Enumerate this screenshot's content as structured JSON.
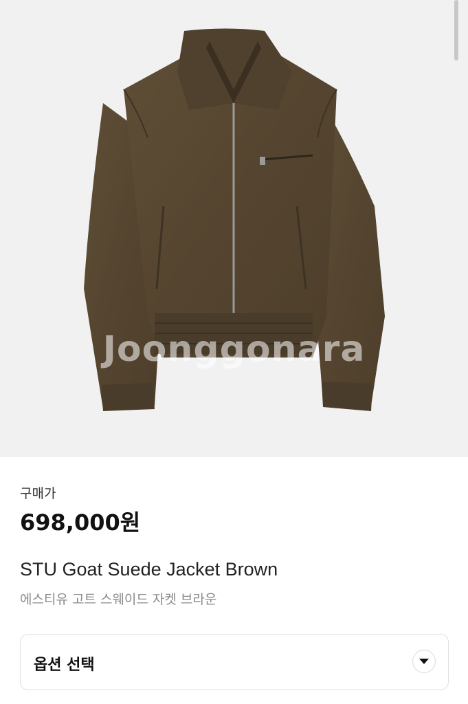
{
  "product": {
    "watermark": "Joonggonara",
    "image_icon": "jacket-photo",
    "price_label": "구매가",
    "price": "698,000원",
    "title": "STU Goat Suede Jacket Brown",
    "subtitle": "에스티유 고트 스웨이드 자켓 브라운"
  },
  "options": {
    "label": "옵션 선택",
    "icon": "chevron-down-icon"
  },
  "colors": {
    "jacket": "#5a4a33",
    "image_background": "#f1f1f1"
  }
}
